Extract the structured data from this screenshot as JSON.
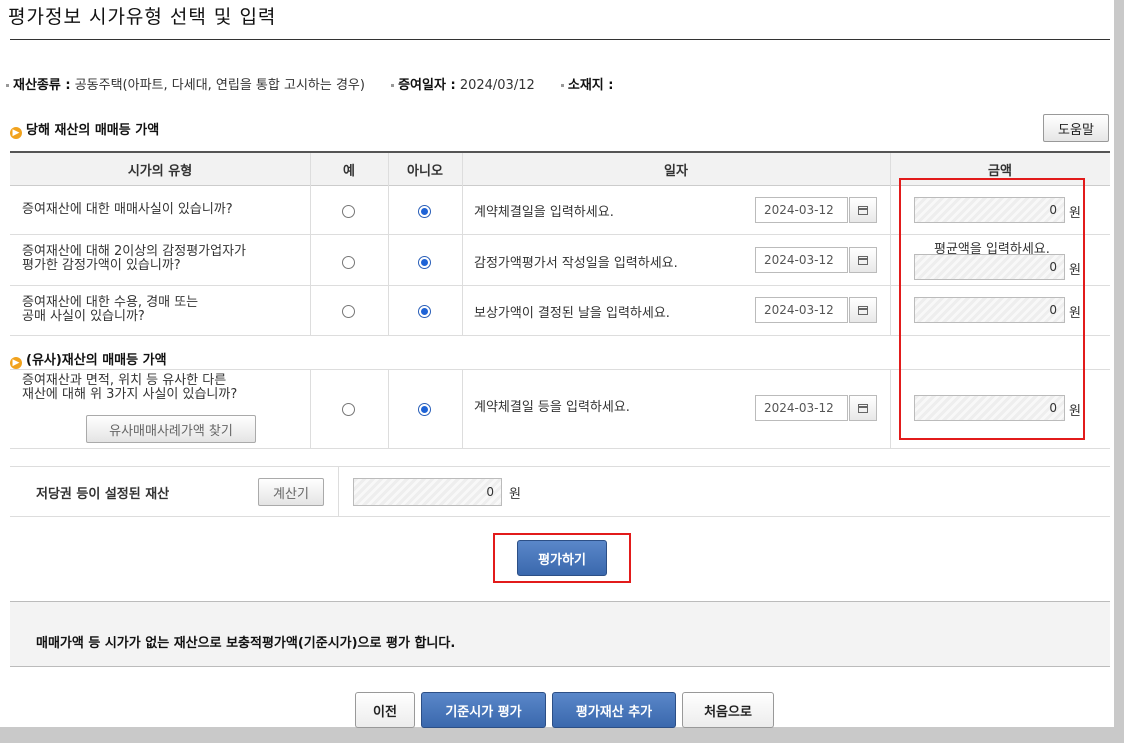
{
  "page": {
    "title": "평가정보 시가유형 선택 및 입력"
  },
  "info": {
    "property_type_label": "재산종류 :",
    "property_type_value": "공동주택(아파트, 다세대, 연립을 통합 고시하는 경우)",
    "gift_date_label": "증여일자 :",
    "gift_date_value": "2024/03/12",
    "location_label": "소재지 :",
    "location_value": ""
  },
  "section1": {
    "title": "당해 재산의 매매등 가액"
  },
  "section2": {
    "title": "(유사)재산의 매매등 가액"
  },
  "help_button": "도움말",
  "table": {
    "headers": {
      "type": "시가의 유형",
      "yes": "예",
      "no": "아니오",
      "date": "일자",
      "amount": "금액"
    }
  },
  "rows": [
    {
      "question_1": "증여재산에 대한 매매사실이 있습니까?",
      "question_2": "",
      "date_label": "계약체결일을 입력하세요.",
      "date": "2024-03-12",
      "amount": "0",
      "unit": "원",
      "selected": "no"
    },
    {
      "question_1": "증여재산에 대해 2이상의 감정평가업자가",
      "question_2": "평가한 감정가액이 있습니까?",
      "date_label": "감정가액평가서 작성일을 입력하세요.",
      "date": "2024-03-12",
      "amount": "0",
      "unit": "원",
      "selected": "no"
    },
    {
      "question_1": "증여재산에 대한 수용, 경매 또는",
      "question_2": "공매 사실이 있습니까?",
      "date_label": "보상가액이 결정된 날을 입력하세요.",
      "date": "2024-03-12",
      "amount": "0",
      "unit": "원",
      "selected": "no"
    },
    {
      "question_1": "증여재산과 면적, 위치 등 유사한 다른",
      "question_2": "재산에 대해 위 3가지 사실이 있습니까?",
      "date_label": "계약체결일 등을 입력하세요.",
      "date": "2024-03-12",
      "amount": "0",
      "unit": "원",
      "selected": "no"
    }
  ],
  "average_hint": "평균액을 입력하세요.",
  "similar_search_button": "유사매매사례가액 찾기",
  "mortgage": {
    "label": "저당권 등이 설정된 재산",
    "calc_button": "계산기",
    "amount": "0",
    "unit": "원"
  },
  "evaluate_button": "평가하기",
  "notice": "매매가액 등 시가가 없는 재산으로 보충적평가액(기준시가)으로 평가 합니다.",
  "footer_buttons": {
    "prev": "이전",
    "standard_eval": "기준시가 평가",
    "add_property": "평가재산 추가",
    "home": "처음으로"
  },
  "colors": {
    "accent_blue": "#3a68ad",
    "highlight_red": "#e21b1b",
    "bullet_orange": "#f1a21d"
  }
}
